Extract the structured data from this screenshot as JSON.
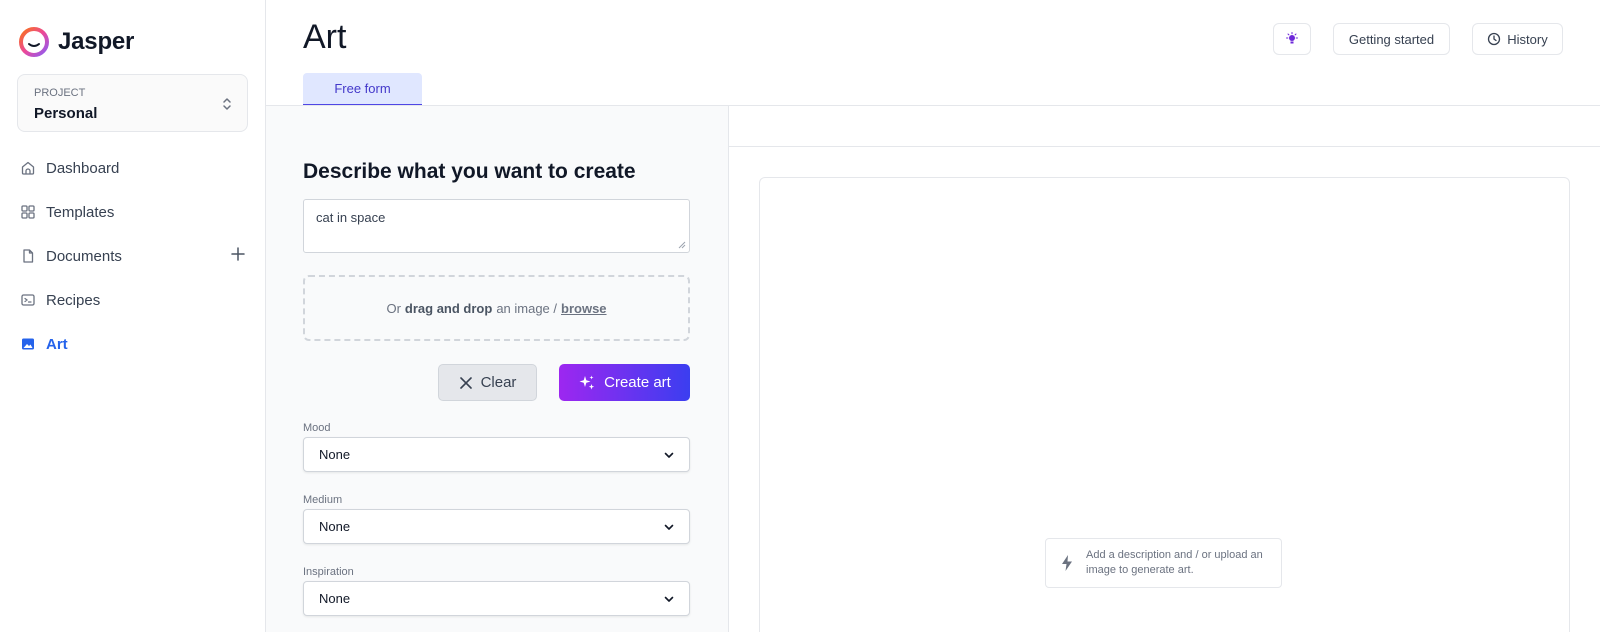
{
  "app": {
    "name": "Jasper"
  },
  "project": {
    "label": "PROJECT",
    "value": "Personal"
  },
  "sidebar": {
    "items": [
      {
        "label": "Dashboard",
        "icon": "home-icon"
      },
      {
        "label": "Templates",
        "icon": "grid-icon"
      },
      {
        "label": "Documents",
        "icon": "document-icon"
      },
      {
        "label": "Recipes",
        "icon": "terminal-icon"
      },
      {
        "label": "Art",
        "icon": "image-icon",
        "active": true
      }
    ]
  },
  "header": {
    "title": "Art",
    "tab": "Free form",
    "getting_started": "Getting started",
    "history": "History"
  },
  "form": {
    "heading": "Describe what you want to create",
    "prompt_value": "cat in space",
    "dropzone": {
      "prefix": "Or",
      "bold": "drag and drop",
      "middle": "an image /",
      "link": "browse"
    },
    "clear_label": "Clear",
    "create_label": "Create art",
    "fields": [
      {
        "label": "Mood",
        "value": "None"
      },
      {
        "label": "Medium",
        "value": "None"
      },
      {
        "label": "Inspiration",
        "value": "None"
      }
    ]
  },
  "result": {
    "hint": "Add a description and / or upload an image to generate art."
  },
  "colors": {
    "accent": "#2563eb",
    "tab_bg": "#e0e7ff",
    "gradient_start": "#9d27f0",
    "gradient_end": "#3b3ef0"
  }
}
